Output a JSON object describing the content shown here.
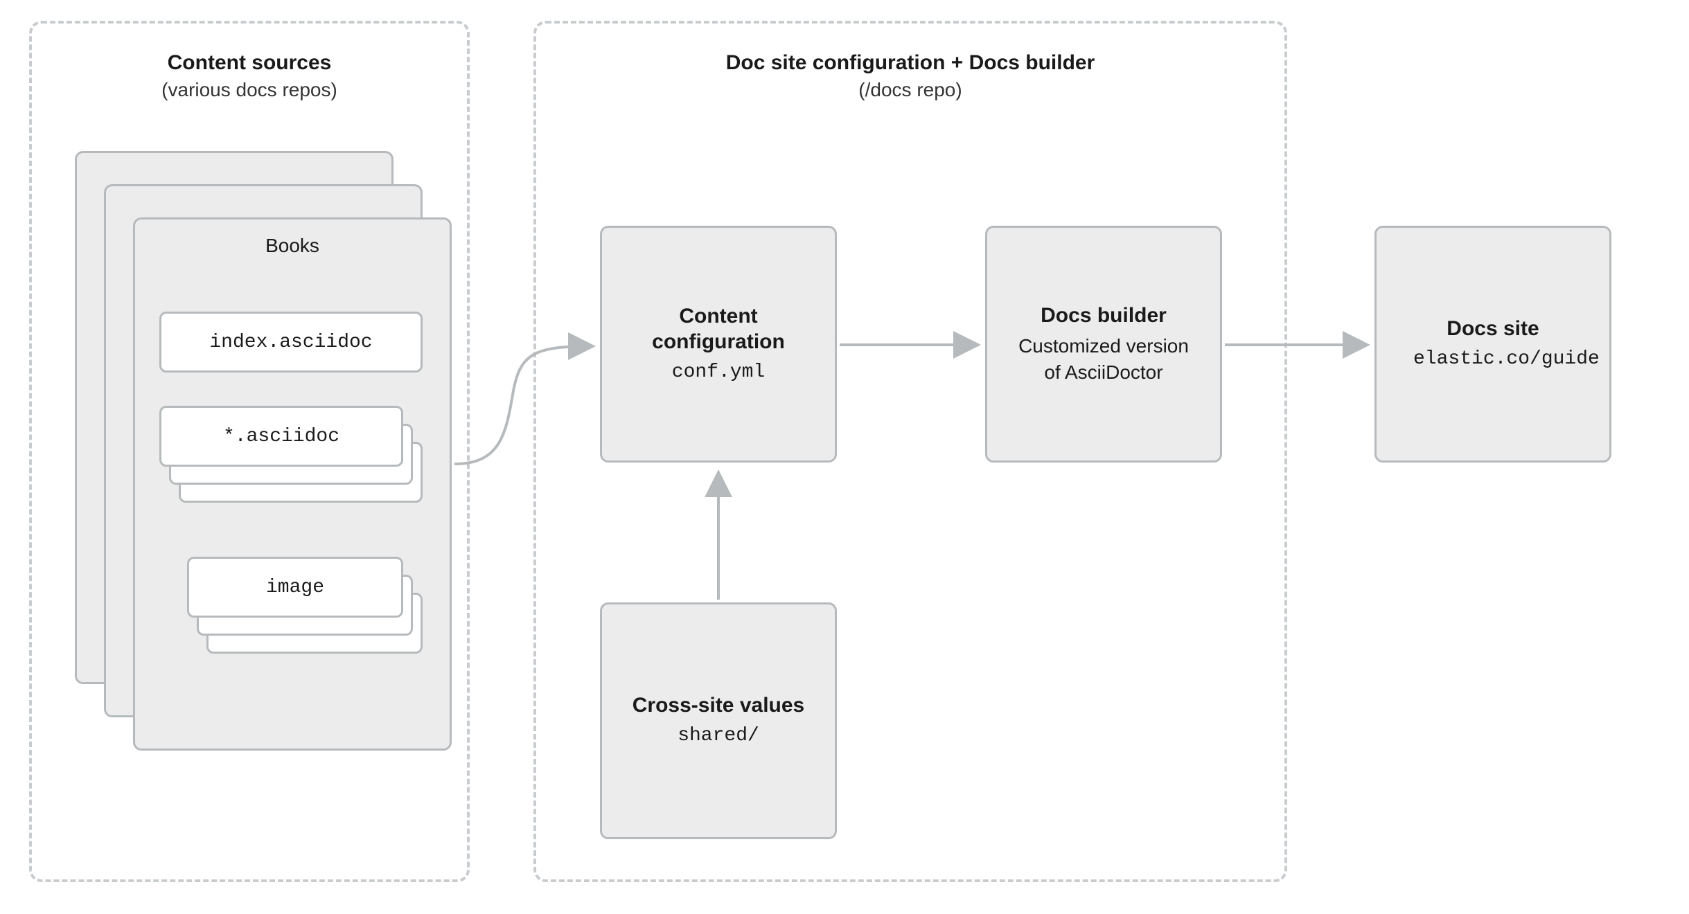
{
  "containers": {
    "sources": {
      "title": "Content sources",
      "subtitle": "(various docs repos)"
    },
    "middle": {
      "title": "Doc site configuration + Docs builder",
      "subtitle": "(/docs repo)"
    }
  },
  "books": {
    "title": "Books",
    "files": {
      "index": "index.asciidoc",
      "pattern": "*.asciidoc",
      "image": "image"
    }
  },
  "nodes": {
    "config": {
      "title": "Content configuration",
      "sub": "conf.yml"
    },
    "cross": {
      "title": "Cross-site values",
      "sub": "shared/"
    },
    "builder": {
      "title": "Docs builder",
      "sub": "Customized version of AsciiDoctor"
    },
    "site": {
      "title": "Docs site",
      "sub": "elastic.co/guide"
    }
  }
}
